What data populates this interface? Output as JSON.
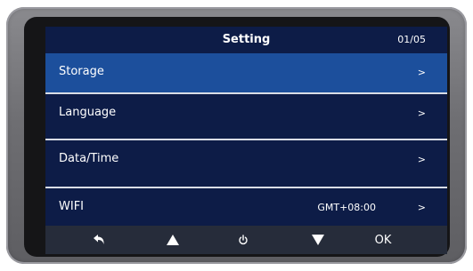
{
  "screen": {
    "title": "Setting",
    "page_indicator": "01/05"
  },
  "menu": {
    "items": [
      {
        "label": "Storage",
        "value": "",
        "chevron": ">"
      },
      {
        "label": "Language",
        "value": "",
        "chevron": ">"
      },
      {
        "label": "Data/Time",
        "value": "",
        "chevron": ">"
      },
      {
        "label": "WIFI",
        "value": "GMT+08:00",
        "chevron": ">"
      }
    ],
    "selected_index": 0
  },
  "footer": {
    "buttons": [
      {
        "icon": "back-arrow-icon"
      },
      {
        "icon": "up-triangle-icon"
      },
      {
        "icon": "power-icon"
      },
      {
        "icon": "down-triangle-icon"
      },
      {
        "label": "OK"
      }
    ]
  },
  "colors": {
    "screen_bg": "#0d1c47",
    "selected_row": "#1c4f9c",
    "footer_bg": "#262c3a",
    "divider": "#d9dde6",
    "device_frame": "#6e6e72"
  }
}
